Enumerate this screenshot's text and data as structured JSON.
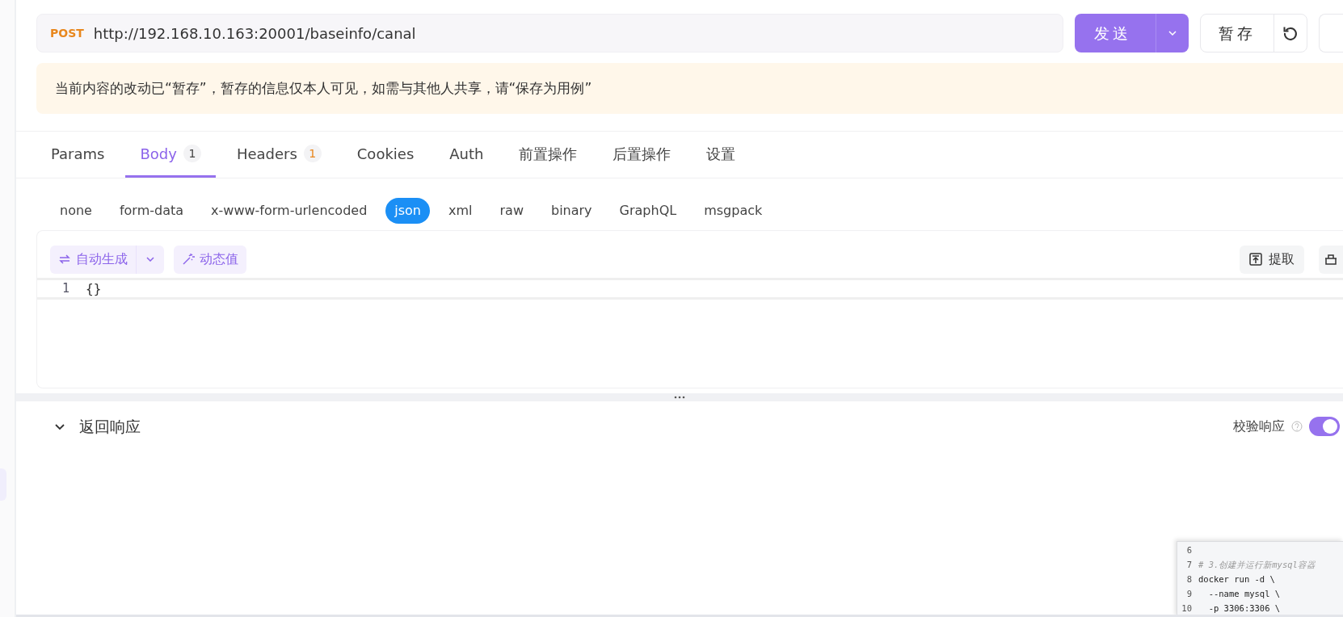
{
  "request": {
    "method": "POST",
    "url": "http://192.168.10.163:20001/baseinfo/canal",
    "send_label": "发送",
    "save_label": "暂存"
  },
  "notice": "当前内容的改动已“暂存”，暂存的信息仅本人可见，如需与其他人共享，请“保存为用例”",
  "tabs": [
    {
      "label": "Params",
      "selected": false
    },
    {
      "label": "Body",
      "count": "1",
      "selected": true
    },
    {
      "label": "Headers",
      "count": "1",
      "selected": false
    },
    {
      "label": "Cookies",
      "selected": false
    },
    {
      "label": "Auth",
      "selected": false
    },
    {
      "label": "前置操作",
      "selected": false
    },
    {
      "label": "后置操作",
      "selected": false
    },
    {
      "label": "设置",
      "selected": false
    }
  ],
  "body_types": [
    {
      "label": "none",
      "selected": false
    },
    {
      "label": "form-data",
      "selected": false
    },
    {
      "label": "x-www-form-urlencoded",
      "selected": false
    },
    {
      "label": "json",
      "selected": true
    },
    {
      "label": "xml",
      "selected": false
    },
    {
      "label": "raw",
      "selected": false
    },
    {
      "label": "binary",
      "selected": false
    },
    {
      "label": "GraphQL",
      "selected": false
    },
    {
      "label": "msgpack",
      "selected": false
    }
  ],
  "editor": {
    "auto_generate": "自动生成",
    "dynamic_value": "动态值",
    "extract": "提取",
    "lines": [
      {
        "number": "1",
        "text": "{}"
      }
    ]
  },
  "response": {
    "title": "返回响应",
    "expanded": true,
    "validate_label": "校验响应",
    "validate_on": true
  },
  "snippet": {
    "lines": [
      {
        "number": "6",
        "kind": "blank"
      },
      {
        "number": "7",
        "text": "# 3.创建并运行新mysql容器",
        "kind": "comment"
      },
      {
        "number": "8",
        "text": "docker run -d \\",
        "kind": "code"
      },
      {
        "number": "9",
        "text": "  --name mysql \\",
        "kind": "code"
      },
      {
        "number": "10",
        "text": "  -p 3306:3306 \\",
        "kind": "code"
      }
    ]
  }
}
